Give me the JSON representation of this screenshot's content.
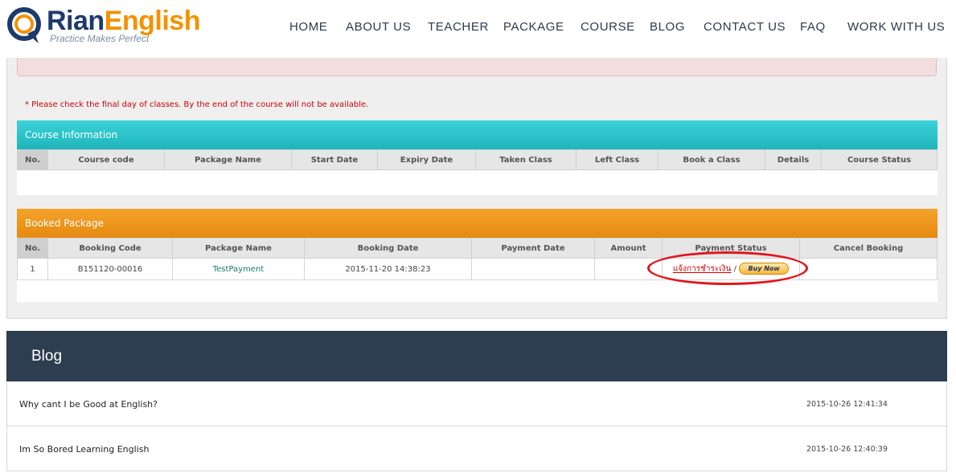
{
  "brand": {
    "name_part1": "Rian",
    "name_part2": "English",
    "tagline": "Practice Makes Perfect"
  },
  "nav": [
    {
      "label": "HOME"
    },
    {
      "label": "ABOUT US"
    },
    {
      "label": "TEACHER"
    },
    {
      "label": "PACKAGE"
    },
    {
      "label": "COURSE"
    },
    {
      "label": "BLOG"
    },
    {
      "label": "CONTACT US"
    },
    {
      "label": "FAQ"
    },
    {
      "label": "WORK WITH US"
    }
  ],
  "notice": "* Please check the final day of classes. By the end of the course will not be available.",
  "course_info": {
    "title": "Course Information",
    "columns": [
      "No.",
      "Course code",
      "Package Name",
      "Start Date",
      "Expiry Date",
      "Taken Class",
      "Left Class",
      "Book a Class",
      "Details",
      "Course Status"
    ]
  },
  "booked_package": {
    "title": "Booked Package",
    "columns": [
      "No.",
      "Booking Code",
      "Package Name",
      "Booking Date",
      "Payment Date",
      "Amount",
      "Payment Status",
      "Cancel Booking"
    ],
    "rows": [
      {
        "no": "1",
        "booking_code": "B151120-00016",
        "package_name": "TestPayment",
        "booking_date": "2015-11-20 14:38:23",
        "payment_date": "",
        "amount": "",
        "payment_link": "แจ้งการชำระเงิน",
        "separator": "/",
        "buy_now": "Buy Now",
        "cancel": ""
      }
    ]
  },
  "blog": {
    "title": "Blog",
    "items": [
      {
        "title": "Why cant I be Good at English?",
        "date": "2015-10-26 12:41:34"
      },
      {
        "title": "Im So Bored Learning English",
        "date": "2015-10-26 12:40:39"
      }
    ]
  },
  "colors": {
    "navy": "#1e3a6d",
    "orange": "#f39200",
    "teal": "#1fb4bb",
    "blog_header": "#2d3e50",
    "alert_red": "#cc0000"
  }
}
